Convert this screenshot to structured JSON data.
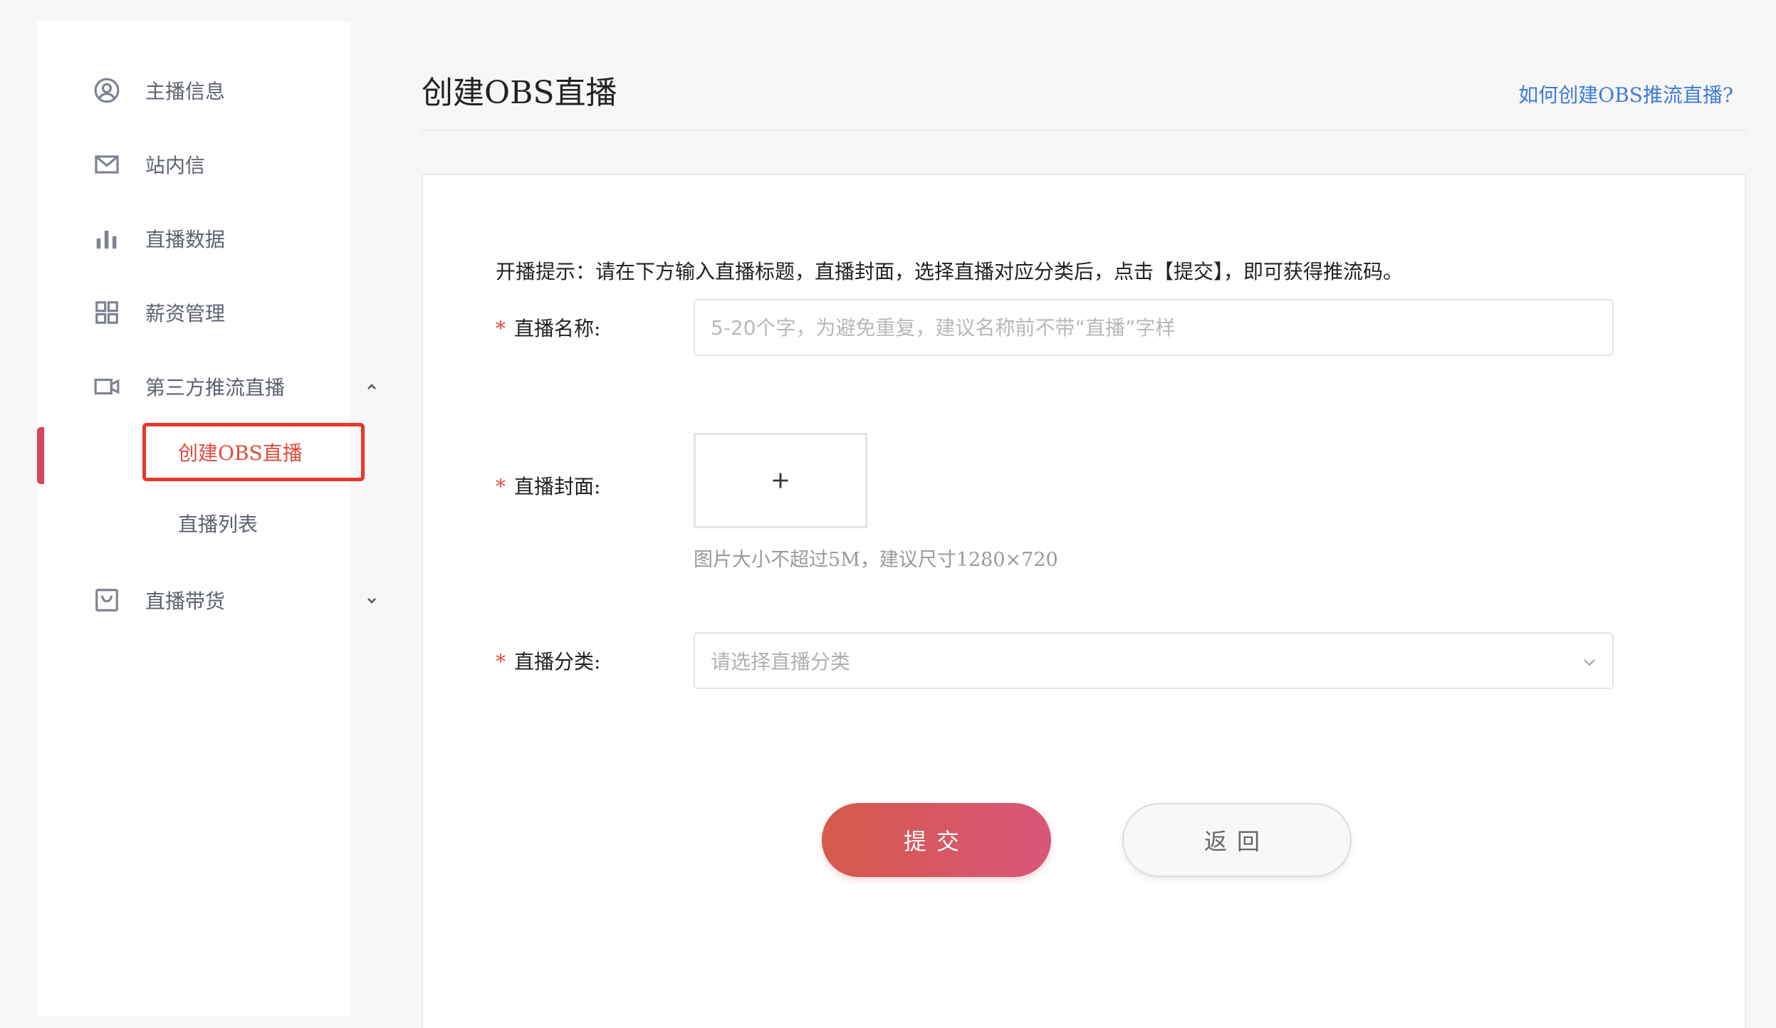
{
  "sidebar": {
    "items": [
      {
        "label": "主播信息",
        "icon": "user-circle-icon"
      },
      {
        "label": "站内信",
        "icon": "mail-icon"
      },
      {
        "label": "直播数据",
        "icon": "bar-chart-icon"
      },
      {
        "label": "薪资管理",
        "icon": "grid-icon"
      },
      {
        "label": "第三方推流直播",
        "icon": "video-camera-icon",
        "expanded": true
      },
      {
        "label": "直播带货",
        "icon": "shopping-bag-icon",
        "expanded": false
      }
    ],
    "sub_items": [
      {
        "label": "创建OBS直播",
        "active": true
      },
      {
        "label": "直播列表",
        "active": false
      }
    ]
  },
  "header": {
    "title": "创建OBS直播",
    "help_link": "如何创建OBS推流直播?"
  },
  "form": {
    "tip": "开播提示：请在下方输入直播标题，直播封面，选择直播对应分类后，点击【提交】，即可获得推流码。",
    "required_mark": "*",
    "name_label": "直播名称:",
    "name_placeholder": "5-20个字，为避免重复，建议名称前不带“直播”字样",
    "name_value": "",
    "cover_label": "直播封面:",
    "cover_hint": "图片大小不超过5M，建议尺寸1280×720",
    "category_label": "直播分类:",
    "category_placeholder": "请选择直播分类",
    "submit_label": "提交",
    "back_label": "返回"
  },
  "colors": {
    "accent": "#e04a3a",
    "link": "#3d7bd9",
    "submit_gradient_start": "#d55a4a",
    "submit_gradient_end": "#d8567a"
  }
}
